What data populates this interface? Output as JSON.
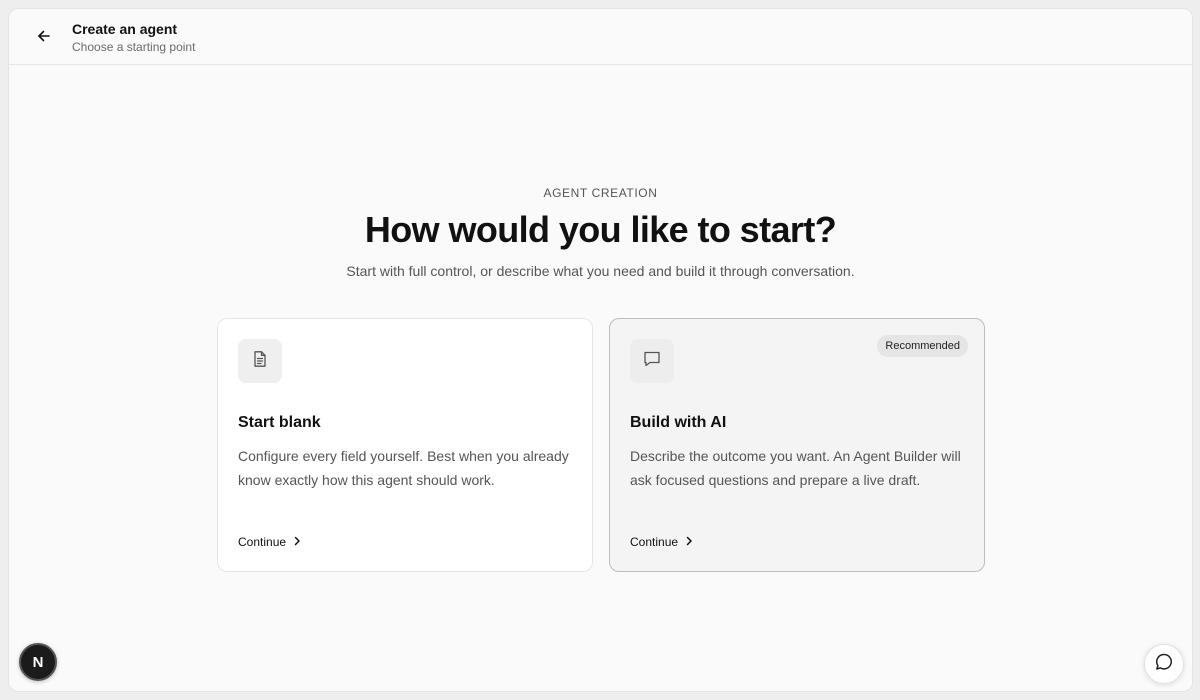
{
  "header": {
    "title": "Create an agent",
    "subtitle": "Choose a starting point",
    "back_icon": "arrow-left-icon"
  },
  "main": {
    "eyebrow": "AGENT CREATION",
    "heading": "How would you like to start?",
    "description": "Start with full control, or describe what you need and build it through conversation."
  },
  "cards": [
    {
      "icon": "document-icon",
      "title": "Start blank",
      "description": "Configure every field yourself. Best when you already know exactly how this agent should work.",
      "cta": "Continue"
    },
    {
      "icon": "chat-bubble-icon",
      "badge": "Recommended",
      "title": "Build with AI",
      "description": "Describe the outcome you want. An Agent Builder will ask focused questions and prepare a live draft.",
      "cta": "Continue"
    }
  ],
  "footer": {
    "avatar_initial": "N",
    "chat_icon": "chat-bubble-icon"
  },
  "colors": {
    "background": "#fafafa",
    "text_primary": "#111111",
    "text_secondary": "#555555",
    "border": "#e6e6e6",
    "selected_border": "#bdbdbd",
    "badge_bg": "#e5e5e5"
  }
}
